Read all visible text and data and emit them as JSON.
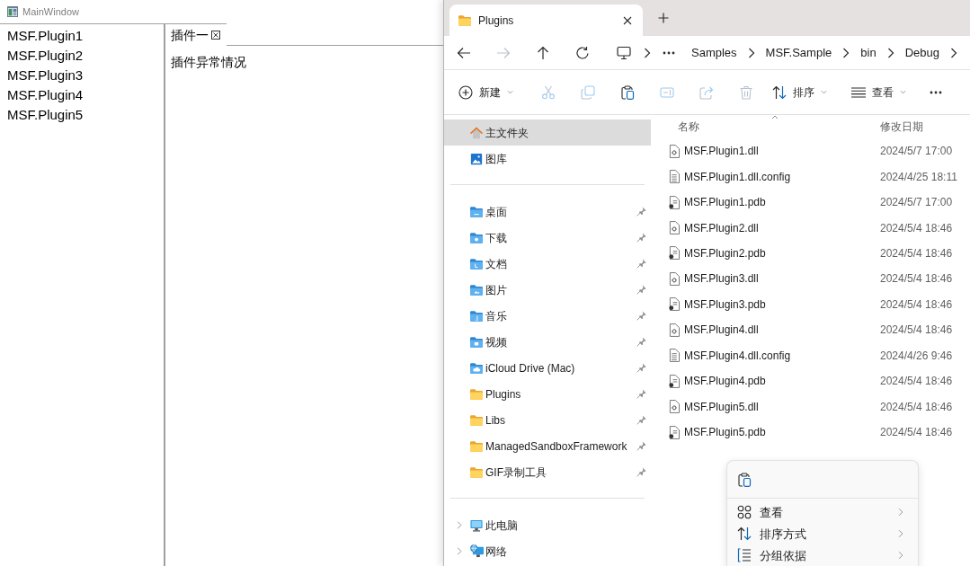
{
  "main_window": {
    "title": "MainWindow",
    "plugins": [
      {
        "label": "MSF.Plugin1",
        "selected": false
      },
      {
        "label": "MSF.Plugin2",
        "selected": false
      },
      {
        "label": "MSF.Plugin3",
        "selected": false
      },
      {
        "label": "MSF.Plugin4",
        "selected": false
      },
      {
        "label": "MSF.Plugin5",
        "selected": false
      }
    ],
    "tabs": [
      {
        "label": "插件一",
        "selected": true,
        "closable": true
      }
    ],
    "content": "插件异常情况"
  },
  "explorer": {
    "tabs": [
      {
        "title": "Plugins",
        "selected": true
      }
    ],
    "nav": [
      {
        "kind": "back",
        "disabled": false
      },
      {
        "kind": "forward",
        "disabled": true
      },
      {
        "kind": "up",
        "disabled": false
      },
      {
        "kind": "refresh",
        "disabled": false
      }
    ],
    "breadcrumb": [
      "Samples",
      "MSF.Sample",
      "bin",
      "Debug"
    ],
    "toolbar": [
      {
        "kind": "new",
        "label": "新建",
        "dropdown": true,
        "disabled": false
      },
      {
        "kind": "cut",
        "disabled": true
      },
      {
        "kind": "copy",
        "disabled": true
      },
      {
        "kind": "paste",
        "disabled": false
      },
      {
        "kind": "rename",
        "disabled": true
      },
      {
        "kind": "share",
        "disabled": true
      },
      {
        "kind": "delete",
        "disabled": true
      },
      {
        "kind": "sort",
        "label": "排序",
        "dropdown": true,
        "disabled": false
      },
      {
        "kind": "view",
        "label": "查看",
        "dropdown": true,
        "disabled": false
      },
      {
        "kind": "more",
        "disabled": false
      }
    ],
    "sidebar": {
      "sections": [
        {
          "items": [
            {
              "kind": "home",
              "label": "主文件夹",
              "selected": true,
              "pinned": false
            },
            {
              "kind": "gallery",
              "label": "图库",
              "selected": false,
              "pinned": false
            }
          ]
        },
        {
          "items": [
            {
              "kind": "desktop",
              "label": "桌面",
              "selected": false,
              "pinned": true
            },
            {
              "kind": "downloads",
              "label": "下载",
              "selected": false,
              "pinned": true
            },
            {
              "kind": "documents",
              "label": "文档",
              "selected": false,
              "pinned": true
            },
            {
              "kind": "pictures",
              "label": "图片",
              "selected": false,
              "pinned": true
            },
            {
              "kind": "music",
              "label": "音乐",
              "selected": false,
              "pinned": true
            },
            {
              "kind": "videos",
              "label": "视频",
              "selected": false,
              "pinned": true
            },
            {
              "kind": "cloud",
              "label": "iCloud Drive (Mac)",
              "selected": false,
              "pinned": true
            },
            {
              "kind": "folder",
              "label": "Plugins",
              "selected": false,
              "pinned": true
            },
            {
              "kind": "folder",
              "label": "Libs",
              "selected": false,
              "pinned": true
            },
            {
              "kind": "folder",
              "label": "ManagedSandboxFramework",
              "selected": false,
              "pinned": true
            },
            {
              "kind": "folder",
              "label": "GIF录制工具",
              "selected": false,
              "pinned": true
            }
          ]
        },
        {
          "items": [
            {
              "kind": "pc",
              "label": "此电脑",
              "selected": false,
              "pinned": false,
              "expanded": false
            },
            {
              "kind": "network",
              "label": "网络",
              "selected": false,
              "pinned": false,
              "expanded": false
            }
          ]
        }
      ]
    },
    "files": {
      "columns": [
        {
          "label": "名称",
          "sorted": true
        },
        {
          "label": "修改日期",
          "sorted": false
        }
      ],
      "rows": [
        {
          "kind": "dll",
          "name": "MSF.Plugin1.dll",
          "modified": "2024/5/7 17:00"
        },
        {
          "kind": "config",
          "name": "MSF.Plugin1.dll.config",
          "modified": "2024/4/25 18:11"
        },
        {
          "kind": "pdb",
          "name": "MSF.Plugin1.pdb",
          "modified": "2024/5/7 17:00"
        },
        {
          "kind": "dll",
          "name": "MSF.Plugin2.dll",
          "modified": "2024/5/4 18:46"
        },
        {
          "kind": "pdb",
          "name": "MSF.Plugin2.pdb",
          "modified": "2024/5/4 18:46"
        },
        {
          "kind": "dll",
          "name": "MSF.Plugin3.dll",
          "modified": "2024/5/4 18:46"
        },
        {
          "kind": "pdb",
          "name": "MSF.Plugin3.pdb",
          "modified": "2024/5/4 18:46"
        },
        {
          "kind": "dll",
          "name": "MSF.Plugin4.dll",
          "modified": "2024/5/4 18:46"
        },
        {
          "kind": "config",
          "name": "MSF.Plugin4.dll.config",
          "modified": "2024/4/26 9:46"
        },
        {
          "kind": "pdb",
          "name": "MSF.Plugin4.pdb",
          "modified": "2024/5/4 18:46"
        },
        {
          "kind": "dll",
          "name": "MSF.Plugin5.dll",
          "modified": "2024/5/4 18:46"
        },
        {
          "kind": "pdb",
          "name": "MSF.Plugin5.pdb",
          "modified": "2024/5/4 18:46"
        }
      ]
    },
    "context_menu": {
      "quick_actions": [
        {
          "kind": "paste"
        }
      ],
      "items": [
        {
          "kind": "view",
          "label": "查看",
          "submenu": true
        },
        {
          "kind": "sort",
          "label": "排序方式",
          "submenu": true
        },
        {
          "kind": "group",
          "label": "分组依据",
          "submenu": true
        }
      ]
    }
  }
}
